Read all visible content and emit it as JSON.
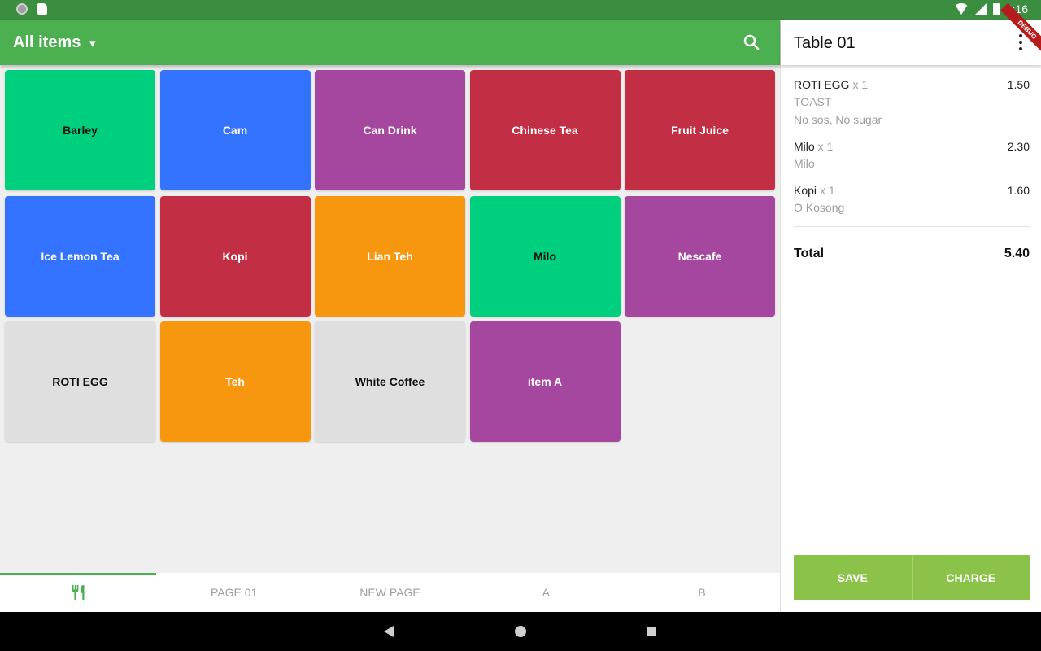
{
  "status_bar": {
    "time": "4:16"
  },
  "appbar": {
    "title": "All items",
    "caret": "▾"
  },
  "tiles": [
    {
      "label": "Barley",
      "color": "#00cf7d",
      "dark": true
    },
    {
      "label": "Cam",
      "color": "#3473ff",
      "dark": false
    },
    {
      "label": "Can Drink",
      "color": "#a5479f",
      "dark": false
    },
    {
      "label": "Chinese Tea",
      "color": "#c22f44",
      "dark": false
    },
    {
      "label": "Fruit Juice",
      "color": "#c22f44",
      "dark": false
    },
    {
      "label": "Ice Lemon Tea",
      "color": "#3473ff",
      "dark": false
    },
    {
      "label": "Kopi",
      "color": "#c22f44",
      "dark": false
    },
    {
      "label": "Lian Teh",
      "color": "#f7970f",
      "dark": false
    },
    {
      "label": "Milo",
      "color": "#00cf7d",
      "dark": true
    },
    {
      "label": "Nescafe",
      "color": "#a5479f",
      "dark": false
    },
    {
      "label": "ROTI EGG",
      "color": "#dfdfdf",
      "dark": true
    },
    {
      "label": "Teh",
      "color": "#f7970f",
      "dark": false
    },
    {
      "label": "White Coffee",
      "color": "#dfdfdf",
      "dark": true
    },
    {
      "label": "item A",
      "color": "#a5479f",
      "dark": false
    }
  ],
  "tabs": [
    {
      "label": "",
      "icon": "cutlery-icon",
      "active": true
    },
    {
      "label": "PAGE 01"
    },
    {
      "label": "NEW PAGE"
    },
    {
      "label": "A"
    },
    {
      "label": "B"
    }
  ],
  "order_panel": {
    "title": "Table 01",
    "items": [
      {
        "name": "ROTI EGG",
        "qty": "x 1",
        "price": "1.50",
        "notes": [
          "TOAST",
          "No sos, No sugar"
        ]
      },
      {
        "name": "Milo",
        "qty": "x 1",
        "price": "2.30",
        "notes": [
          "Milo"
        ]
      },
      {
        "name": "Kopi",
        "qty": "x 1",
        "price": "1.60",
        "notes": [
          "O Kosong"
        ]
      }
    ],
    "total_label": "Total",
    "total_value": "5.40",
    "save_label": "SAVE",
    "charge_label": "CHARGE",
    "ribbon": "DEBUG"
  },
  "colors": {
    "primary": "#4caf50",
    "status_bar": "#3b8e3f",
    "action": "#8bc34a"
  },
  "icons": {
    "search": "search-icon",
    "more": "more-vert-icon",
    "back": "back-icon",
    "home": "home-icon",
    "recent": "recent-apps-icon"
  }
}
